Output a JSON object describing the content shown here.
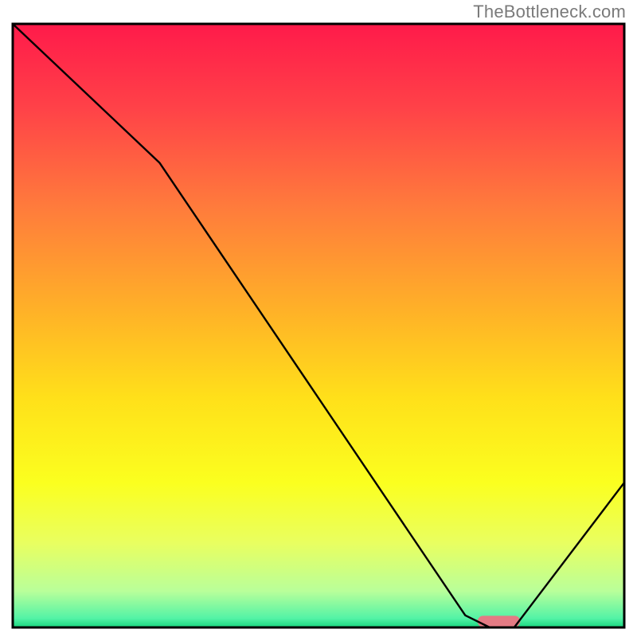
{
  "attribution": "TheBottleneck.com",
  "chart_data": {
    "type": "line",
    "title": "",
    "xlabel": "",
    "ylabel": "",
    "xlim": [
      0,
      100
    ],
    "ylim": [
      0,
      100
    ],
    "grid": false,
    "series": [
      {
        "name": "curve",
        "x": [
          0,
          24,
          74,
          78,
          82,
          100
        ],
        "y": [
          100,
          77,
          2,
          0,
          0,
          24
        ]
      }
    ],
    "marker": {
      "x_range": [
        76,
        83
      ],
      "y": 1,
      "color": "#e47b84"
    },
    "gradient_stops": [
      {
        "offset": 0.0,
        "color": "#ff1a4a"
      },
      {
        "offset": 0.14,
        "color": "#ff4248"
      },
      {
        "offset": 0.3,
        "color": "#ff7a3c"
      },
      {
        "offset": 0.48,
        "color": "#ffb327"
      },
      {
        "offset": 0.62,
        "color": "#ffe01a"
      },
      {
        "offset": 0.76,
        "color": "#fbff1f"
      },
      {
        "offset": 0.86,
        "color": "#e9ff60"
      },
      {
        "offset": 0.94,
        "color": "#b9ff9a"
      },
      {
        "offset": 0.985,
        "color": "#53f3a6"
      },
      {
        "offset": 1.0,
        "color": "#18d67e"
      }
    ],
    "frame_color": "#000000",
    "line_color": "#000000",
    "line_width": 2.4
  }
}
